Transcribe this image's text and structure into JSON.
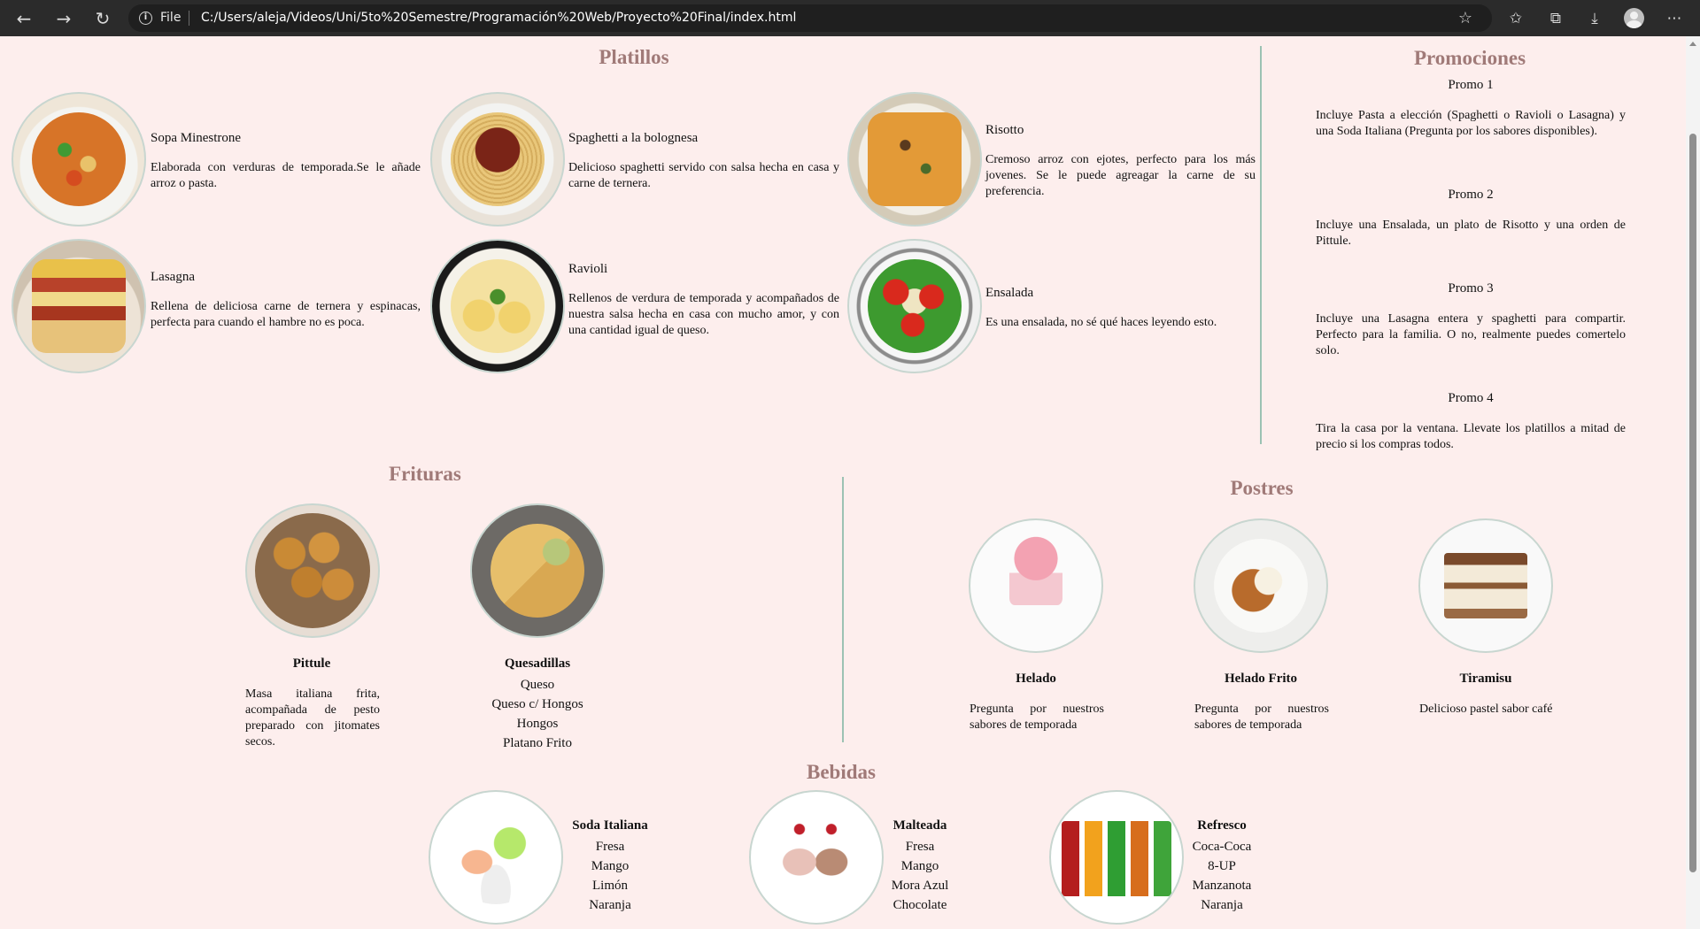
{
  "browser": {
    "file_label": "File",
    "url": "C:/Users/aleja/Videos/Uni/5to%20Semestre/Programación%20Web/Proyecto%20Final/index.html"
  },
  "platillos": {
    "title": "Platillos",
    "items": [
      {
        "name": "Sopa Minestrone",
        "desc": "Elaborada con verduras de temporada.Se le añade arroz o pasta."
      },
      {
        "name": "Spaghetti a la bolognesa",
        "desc": "Delicioso spaghetti servido con salsa hecha en casa y carne de ternera."
      },
      {
        "name": "Risotto",
        "desc": "Cremoso arroz con ejotes, perfecto para los más jovenes. Se le puede agreagar la carne de su preferencia."
      },
      {
        "name": "Lasagna",
        "desc": "Rellena de deliciosa carne de ternera y espinacas, perfecta para cuando el hambre no es poca."
      },
      {
        "name": "Ravioli",
        "desc": "Rellenos de verdura de temporada y acompañados de nuestra salsa hecha en casa con mucho amor, y con una cantidad igual de queso."
      },
      {
        "name": "Ensalada",
        "desc": "Es una ensalada, no sé qué haces leyendo esto."
      }
    ]
  },
  "promociones": {
    "title": "Promociones",
    "items": [
      {
        "name": "Promo 1",
        "desc": "Incluye Pasta a elección (Spaghetti o Ravioli o Lasagna) y una Soda Italiana (Pregunta por los sabores disponibles)."
      },
      {
        "name": "Promo 2",
        "desc": "Incluye una Ensalada, un plato de Risotto y una orden de Pittule."
      },
      {
        "name": "Promo 3",
        "desc": "Incluye una Lasagna entera y spaghetti para compartir. Perfecto para la familia. O no, realmente puedes comertelo solo."
      },
      {
        "name": "Promo 4",
        "desc": "Tira la casa por la ventana. Llevate los platillos a mitad de precio si los compras todos."
      }
    ]
  },
  "frituras": {
    "title": "Frituras",
    "pittule": {
      "name": "Pittule",
      "desc": "Masa italiana frita, acompañada de pesto preparado con jitomates secos."
    },
    "quesadillas": {
      "name": "Quesadillas",
      "options": [
        "Queso",
        "Queso c/ Hongos",
        "Hongos",
        "Platano Frito"
      ]
    }
  },
  "postres": {
    "title": "Postres",
    "items": [
      {
        "name": "Helado",
        "desc": "Pregunta por nuestros sabores de temporada"
      },
      {
        "name": "Helado Frito",
        "desc": "Pregunta por nuestros sabores de temporada"
      },
      {
        "name": "Tiramisu",
        "desc": "Delicioso pastel sabor café"
      }
    ]
  },
  "bebidas": {
    "title": "Bebidas",
    "items": [
      {
        "name": "Soda Italiana",
        "options": [
          "Fresa",
          "Mango",
          "Limón",
          "Naranja"
        ]
      },
      {
        "name": "Malteada",
        "options": [
          "Fresa",
          "Mango",
          "Mora Azul",
          "Chocolate"
        ]
      },
      {
        "name": "Refresco",
        "options": [
          "Coca-Coca",
          "8-UP",
          "Manzanota",
          "Naranja"
        ]
      }
    ]
  },
  "icons": [
    "back-arrow-icon",
    "forward-arrow-icon",
    "refresh-icon",
    "info-icon",
    "favorite-add-icon",
    "favorites-icon",
    "collections-icon",
    "download-icon",
    "profile-avatar-icon",
    "more-options-icon"
  ]
}
